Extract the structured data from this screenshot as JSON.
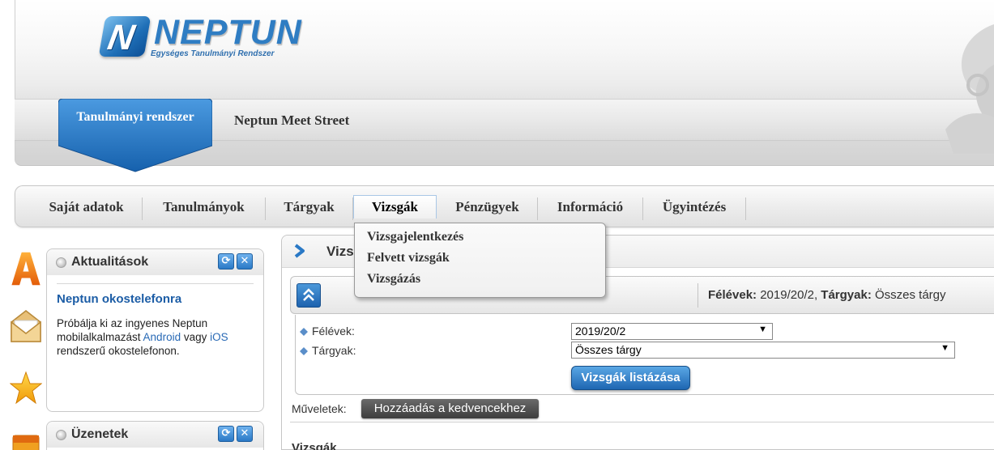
{
  "logo": {
    "name": "NEPTUN",
    "tagline": "Egységes Tanulmányi Rendszer"
  },
  "header": {
    "system_tab": "Tanulmányi rendszer",
    "secondary_link": "Neptun Meet Street"
  },
  "main_nav": {
    "items": [
      {
        "label": "Saját adatok"
      },
      {
        "label": "Tanulmányok"
      },
      {
        "label": "Tárgyak"
      },
      {
        "label": "Vizsgák",
        "active": true
      },
      {
        "label": "Pénzügyek"
      },
      {
        "label": "Információ"
      },
      {
        "label": "Ügyintézés"
      }
    ]
  },
  "dropdown": {
    "items": [
      "Vizsgajelentkezés",
      "Felvett vizsgák",
      "Vizsgázás"
    ]
  },
  "widgets": {
    "news": {
      "title": "Aktualitások",
      "item_title": "Neptun okostelefonra",
      "body_1": "Próbálja ki az ingyenes Neptun mobilalkalmazást ",
      "link_android": "Android",
      "body_2": " vagy ",
      "link_ios": "iOS",
      "body_3": " rendszerű okostelefonon."
    },
    "messages": {
      "title": "Üzenetek"
    }
  },
  "content": {
    "title_partial": "Vizs",
    "filter_summary": {
      "semester_label": "Félévek:",
      "semester_value": "2019/20/2,",
      "subject_label": "Tárgyak:",
      "subject_value": "Összes tárgy"
    },
    "filters": {
      "semester_label": "Félévek:",
      "semester_selected": "2019/20/2",
      "subject_label": "Tárgyak:",
      "subject_selected": "Összes tárgy"
    },
    "list_button": "Vizsgák listázása",
    "operations_label": "Műveletek:",
    "favorite_button": "Hozzáadás a kedvencekhez",
    "bottom_partial": "Vizsgák"
  },
  "colors": {
    "accent_blue": "#2a79c6",
    "link_blue": "#1c5da6"
  }
}
